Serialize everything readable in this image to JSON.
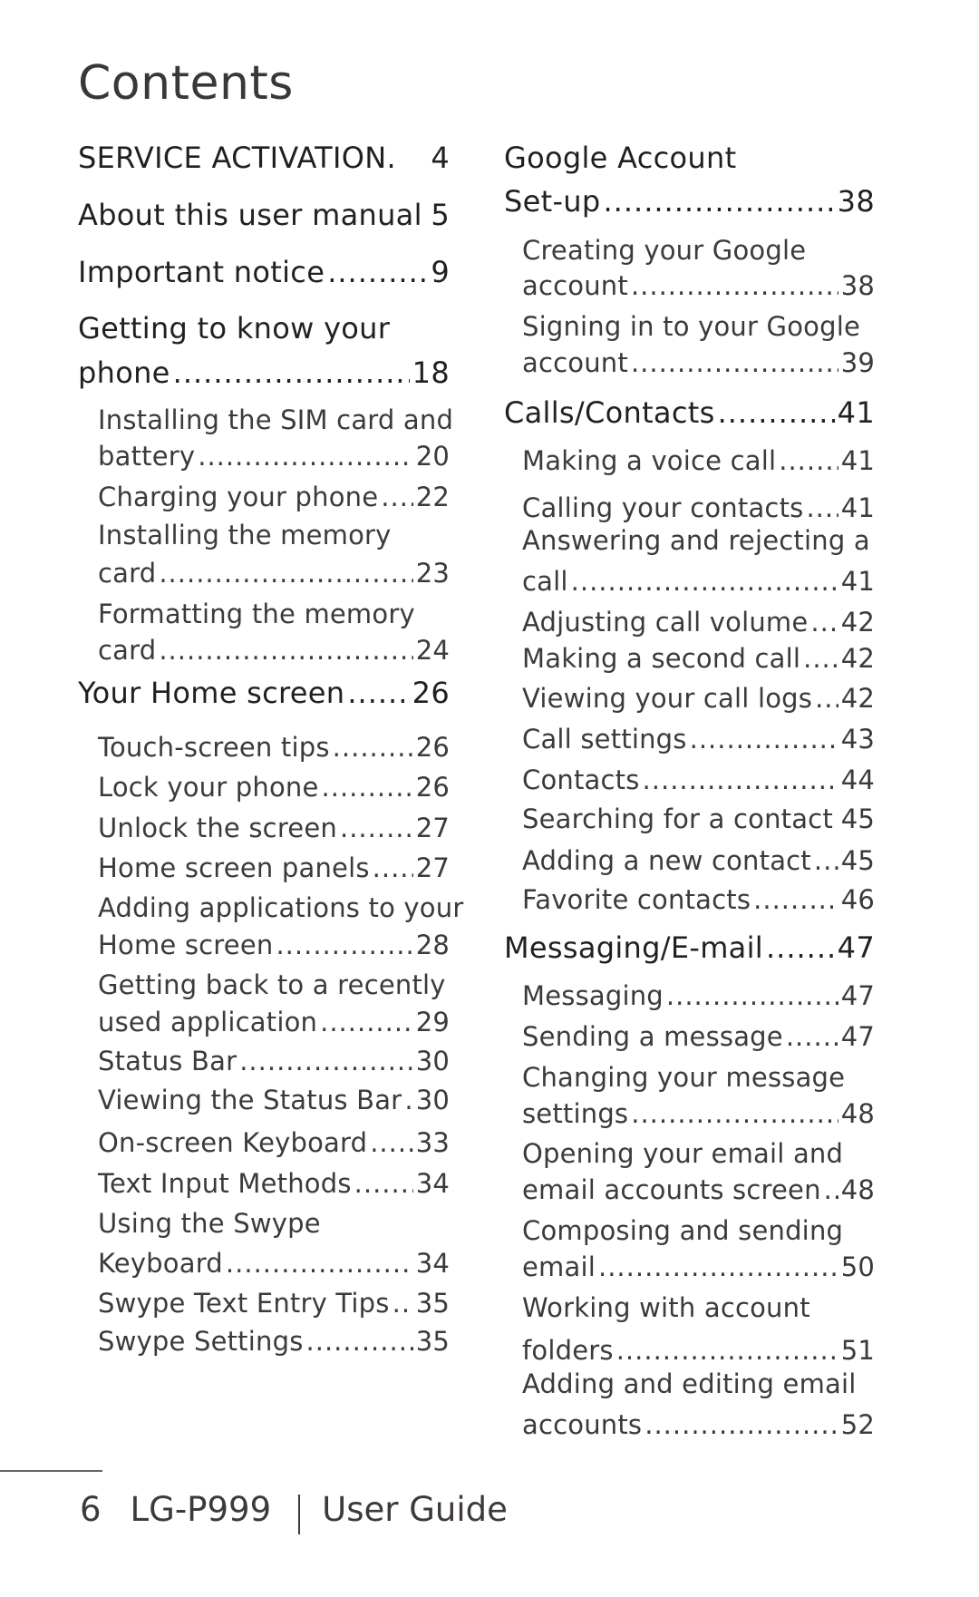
{
  "title": "Contents",
  "columns": [
    {
      "entries": [
        {
          "level": "heading",
          "lines": [
            "SERVICE ACTIVATION."
          ],
          "page": "4",
          "dots": false
        },
        {
          "level": "heading",
          "lines": [
            "About this user manual"
          ],
          "page": "5",
          "dots": false
        },
        {
          "level": "heading",
          "lines": [
            "Important notice"
          ],
          "page": "9",
          "dots": true
        },
        {
          "level": "heading",
          "lines": [
            "Getting to know your",
            "phone"
          ],
          "page": "18",
          "dots": true
        },
        {
          "level": "sub",
          "lines": [
            "Installing the SIM card and",
            "battery"
          ],
          "page": "20",
          "dots": true
        },
        {
          "level": "sub",
          "lines": [
            "Charging your phone"
          ],
          "page": "22",
          "dots": true
        },
        {
          "level": "sub",
          "lines": [
            "Installing the memory",
            "card"
          ],
          "page": "23",
          "dots": true
        },
        {
          "level": "sub",
          "lines": [
            "Formatting the memory",
            "card"
          ],
          "page": "24",
          "dots": true
        },
        {
          "level": "heading",
          "lines": [
            "Your Home screen"
          ],
          "page": "26",
          "dots": true
        },
        {
          "level": "sub",
          "lines": [
            "Touch-screen tips"
          ],
          "page": "26",
          "dots": true
        },
        {
          "level": "sub",
          "lines": [
            "Lock your phone"
          ],
          "page": "26",
          "dots": true
        },
        {
          "level": "sub",
          "lines": [
            "Unlock the screen"
          ],
          "page": "27",
          "dots": true
        },
        {
          "level": "sub",
          "lines": [
            "Home screen panels"
          ],
          "page": "27",
          "dots": true
        },
        {
          "level": "sub",
          "lines": [
            "Adding applications to your",
            "Home screen"
          ],
          "page": "28",
          "dots": true
        },
        {
          "level": "sub",
          "lines": [
            "Getting back to a recently",
            "used application"
          ],
          "page": "29",
          "dots": true
        },
        {
          "level": "sub",
          "lines": [
            "Status Bar"
          ],
          "page": "30",
          "dots": true
        },
        {
          "level": "sub",
          "lines": [
            "Viewing the Status Bar"
          ],
          "page": "30",
          "dots": true
        },
        {
          "level": "sub",
          "lines": [
            "On-screen Keyboard"
          ],
          "page": "33",
          "dots": true
        },
        {
          "level": "sub",
          "lines": [
            "Text Input Methods"
          ],
          "page": "34",
          "dots": true
        },
        {
          "level": "sub",
          "lines": [
            "Using the Swype",
            "Keyboard"
          ],
          "page": "34",
          "dots": true
        },
        {
          "level": "sub",
          "lines": [
            "Swype Text Entry Tips"
          ],
          "page": "35",
          "dots": true
        },
        {
          "level": "sub",
          "lines": [
            "Swype Settings"
          ],
          "page": "35",
          "dots": true
        }
      ]
    },
    {
      "entries": [
        {
          "level": "heading",
          "lines": [
            "Google Account",
            "Set-up"
          ],
          "page": "38",
          "dots": true
        },
        {
          "level": "sub",
          "lines": [
            "Creating your Google",
            "account"
          ],
          "page": "38",
          "dots": true
        },
        {
          "level": "sub",
          "lines": [
            "Signing in to your Google",
            "account"
          ],
          "page": "39",
          "dots": true
        },
        {
          "level": "heading",
          "lines": [
            "Calls/Contacts"
          ],
          "page": "41",
          "dots": true
        },
        {
          "level": "sub",
          "lines": [
            "Making a voice call"
          ],
          "page": "41",
          "dots": true
        },
        {
          "level": "sub",
          "lines": [
            "Calling your contacts"
          ],
          "page": "41",
          "dots": true
        },
        {
          "level": "sub",
          "lines": [
            "Answering and rejecting a",
            "call"
          ],
          "page": "41",
          "dots": true
        },
        {
          "level": "sub",
          "lines": [
            "Adjusting call volume"
          ],
          "page": "42",
          "dots": true
        },
        {
          "level": "sub",
          "lines": [
            "Making a second call"
          ],
          "page": "42",
          "dots": true
        },
        {
          "level": "sub",
          "lines": [
            "Viewing your call logs"
          ],
          "page": "42",
          "dots": true
        },
        {
          "level": "sub",
          "lines": [
            "Call settings"
          ],
          "page": "43",
          "dots": true
        },
        {
          "level": "sub",
          "lines": [
            "Contacts"
          ],
          "page": "44",
          "dots": true
        },
        {
          "level": "sub",
          "lines": [
            "Searching for a contact"
          ],
          "page": "45",
          "dots": true
        },
        {
          "level": "sub",
          "lines": [
            "Adding a new contact"
          ],
          "page": "45",
          "dots": true
        },
        {
          "level": "sub",
          "lines": [
            "Favorite contacts"
          ],
          "page": "46",
          "dots": true
        },
        {
          "level": "heading",
          "lines": [
            "Messaging/E-mail"
          ],
          "page": "47",
          "dots": true
        },
        {
          "level": "sub",
          "lines": [
            "Messaging"
          ],
          "page": "47",
          "dots": true
        },
        {
          "level": "sub",
          "lines": [
            "Sending a message"
          ],
          "page": "47",
          "dots": true
        },
        {
          "level": "sub",
          "lines": [
            "Changing your message",
            "settings"
          ],
          "page": "48",
          "dots": true
        },
        {
          "level": "sub",
          "lines": [
            "Opening your email and",
            "email accounts screen"
          ],
          "page": "48",
          "dots": true
        },
        {
          "level": "sub",
          "lines": [
            "Composing and sending",
            "email"
          ],
          "page": "50",
          "dots": true
        },
        {
          "level": "sub",
          "lines": [
            "Working with account",
            "folders"
          ],
          "page": "51",
          "dots": true
        },
        {
          "level": "sub",
          "lines": [
            "Adding and editing email",
            "accounts"
          ],
          "page": "52",
          "dots": true
        }
      ]
    }
  ],
  "footer": {
    "page_number": "6",
    "model": "LG-P999",
    "guide": "User Guide"
  }
}
